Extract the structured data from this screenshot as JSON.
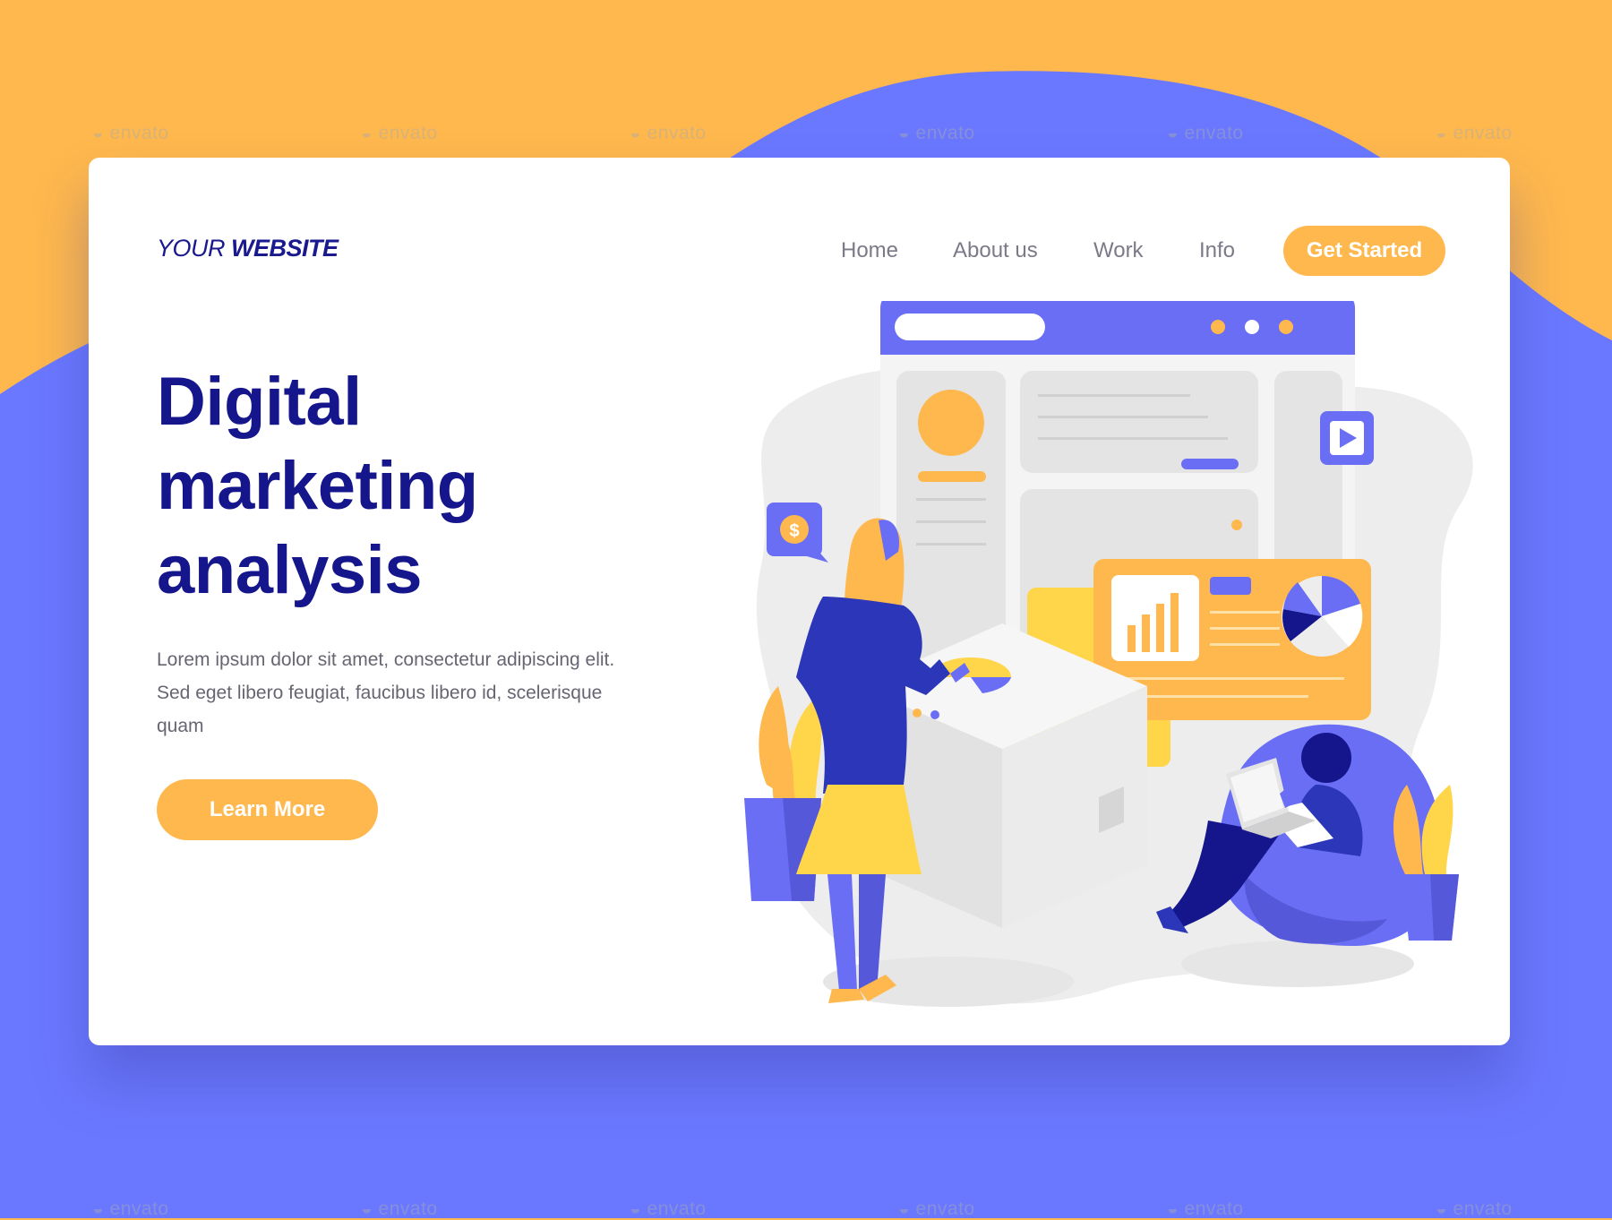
{
  "colors": {
    "background_top": "#FFB84D",
    "background_blob": "#6A78FF",
    "accent_orange": "#FFB84D",
    "accent_yellow": "#FFD54A",
    "brand_navy": "#15158C",
    "illustration_purple": "#6A6EF5",
    "card": "#FFFFFF",
    "text_gray": "#666672"
  },
  "header": {
    "logo_light": "YOUR",
    "logo_bold": "WEBSITE",
    "nav": [
      {
        "label": "Home"
      },
      {
        "label": "About us"
      },
      {
        "label": "Work"
      },
      {
        "label": "Info"
      }
    ],
    "cta_label": "Get Started"
  },
  "hero": {
    "title_lines": [
      "Digital",
      "marketing",
      "analysis"
    ],
    "description": "Lorem ipsum dolor sit amet, consectetur adipiscing elit. Sed eget libero feugiat, faucibus libero id, scelerisque quam",
    "button_label": "Learn More"
  },
  "watermark": {
    "text": "envato"
  },
  "icons": [
    "dollar-icon",
    "play-icon",
    "bar-chart-icon",
    "pie-chart-icon",
    "laptop-icon",
    "plant-icon"
  ]
}
